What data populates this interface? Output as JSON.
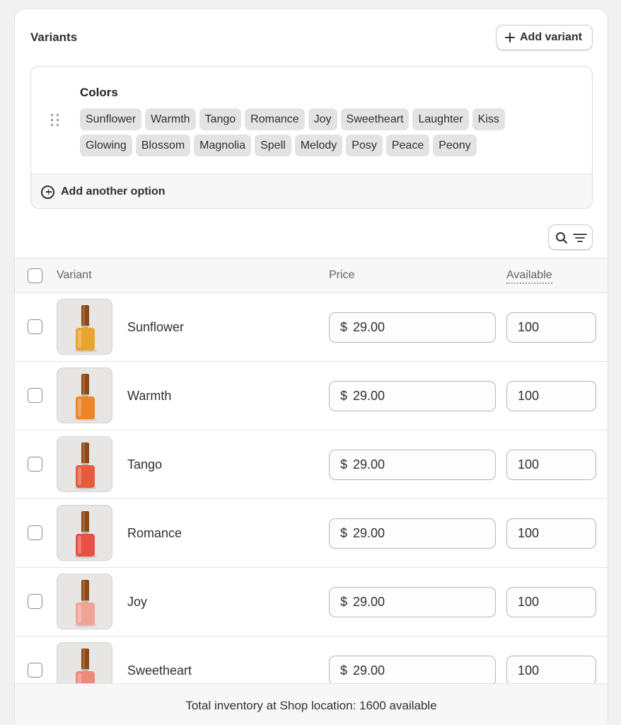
{
  "card": {
    "title": "Variants",
    "add_variant_label": "Add variant"
  },
  "options": {
    "name": "Colors",
    "values": [
      "Sunflower",
      "Warmth",
      "Tango",
      "Romance",
      "Joy",
      "Sweetheart",
      "Laughter",
      "Kiss",
      "Glowing",
      "Blossom",
      "Magnolia",
      "Spell",
      "Melody",
      "Posy",
      "Peace",
      "Peony"
    ],
    "add_another_label": "Add another option"
  },
  "table": {
    "headers": {
      "variant": "Variant",
      "price": "Price",
      "available": "Available"
    },
    "rows": [
      {
        "name": "Sunflower",
        "currency": "$",
        "price": "29.00",
        "available": "100",
        "polish_color": "#e8a52e"
      },
      {
        "name": "Warmth",
        "currency": "$",
        "price": "29.00",
        "available": "100",
        "polish_color": "#ee8428"
      },
      {
        "name": "Tango",
        "currency": "$",
        "price": "29.00",
        "available": "100",
        "polish_color": "#e85a3c"
      },
      {
        "name": "Romance",
        "currency": "$",
        "price": "29.00",
        "available": "100",
        "polish_color": "#e84f46"
      },
      {
        "name": "Joy",
        "currency": "$",
        "price": "29.00",
        "available": "100",
        "polish_color": "#f0a496"
      },
      {
        "name": "Sweetheart",
        "currency": "$",
        "price": "29.00",
        "available": "100",
        "polish_color": "#ee8a7c"
      }
    ]
  },
  "footer": {
    "text": "Total inventory at Shop location: 1600 available"
  },
  "icons": {
    "add": "plus-icon",
    "add_option": "circle-plus-icon",
    "drag": "drag-handle-icon",
    "search": "search-icon",
    "filter": "filter-icon"
  },
  "colors": {
    "card_bg": "#ffffff",
    "page_bg": "#f1f1f1",
    "tag_bg": "#e3e3e3",
    "cap_color": "#8a4a1a"
  }
}
